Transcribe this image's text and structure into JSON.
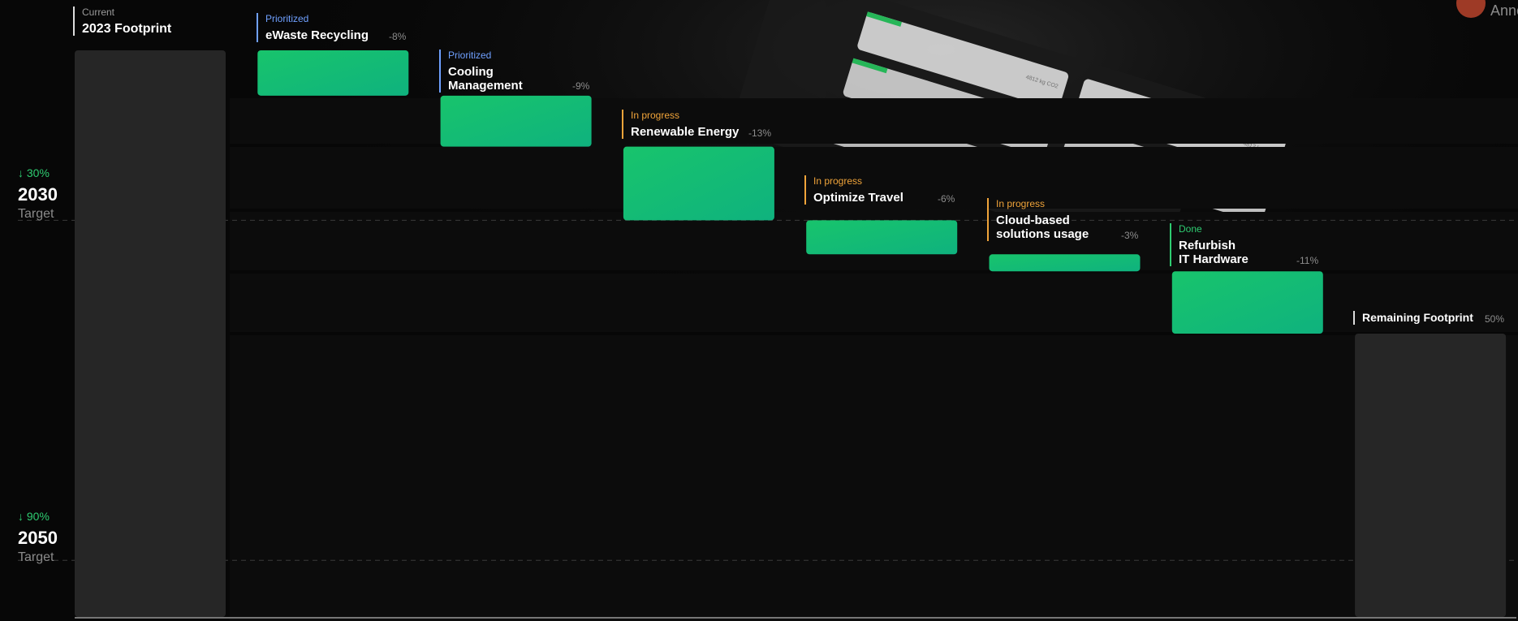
{
  "chart_data": {
    "type": "waterfall",
    "y_domain": [
      0,
      100
    ],
    "start": {
      "status": "Current",
      "label": "2023 Footprint",
      "value": 100
    },
    "steps": [
      {
        "status": "Prioritized",
        "label": "eWaste Recycling",
        "delta": -8,
        "delta_label": "-8%",
        "status_color": "#6fa0ff"
      },
      {
        "status": "Prioritized",
        "label": "Cooling\nManagement",
        "delta": -9,
        "delta_label": "-9%",
        "status_color": "#6fa0ff"
      },
      {
        "status": "In progress",
        "label": "Renewable Energy",
        "delta": -13,
        "delta_label": "-13%",
        "status_color": "#f0a43a"
      },
      {
        "status": "In progress",
        "label": "Optimize Travel",
        "delta": -6,
        "delta_label": "-6%",
        "status_color": "#f0a43a"
      },
      {
        "status": "In progress",
        "label": "Cloud-based\nsolutions usage",
        "delta": -3,
        "delta_label": "-3%",
        "status_color": "#f0a43a"
      },
      {
        "status": "Done",
        "label": "Refurbish\nIT Hardware",
        "delta": -11,
        "delta_label": "-11%",
        "status_color": "#2ecc71"
      }
    ],
    "end": {
      "label": "Remaining Footprint",
      "value": 50,
      "value_label": "50%"
    },
    "targets": [
      {
        "reduction_label": "↓ 30%",
        "year": "2030",
        "caption": "Target",
        "reduction": 30
      },
      {
        "reduction_label": "↓ 90%",
        "year": "2050",
        "caption": "Target",
        "reduction": 90
      }
    ],
    "colors": {
      "bar": "#18c46c",
      "bar_alt": "#0fb27e",
      "total_bar": "#262626",
      "accent": "#2ecc71"
    }
  },
  "background": {
    "partial_name": "Anne",
    "card_caption": "4812 kg CO2"
  }
}
